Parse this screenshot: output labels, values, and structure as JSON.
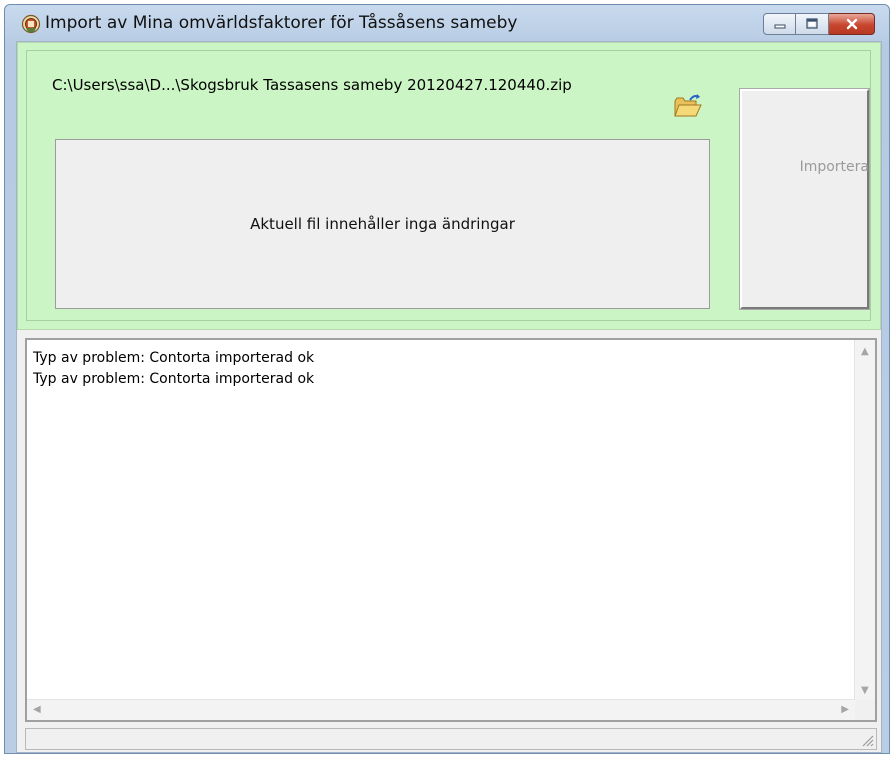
{
  "window": {
    "title": "Import av Mina omvärldsfaktorer för Tåssåsens sameby",
    "icons": {
      "app": "app-icon",
      "minimize": "minimize-icon",
      "maximize": "maximize-icon",
      "close": "close-icon"
    }
  },
  "import_panel": {
    "file_path": "C:\\Users\\ssa\\D...\\Skogsbruk Tassasens sameby 20120427.120440.zip",
    "browse_icon": "folder-open-icon",
    "status_message": "Aktuell fil innehåller inga ändringar",
    "import_button_label": "Importera",
    "import_button_enabled": false,
    "colors": {
      "panel_bg": "#ccf5c5"
    }
  },
  "log": {
    "lines": [
      "Typ av problem: Contorta importerad ok",
      "Typ av problem: Contorta importerad ok"
    ]
  },
  "statusbar": {
    "text": ""
  }
}
